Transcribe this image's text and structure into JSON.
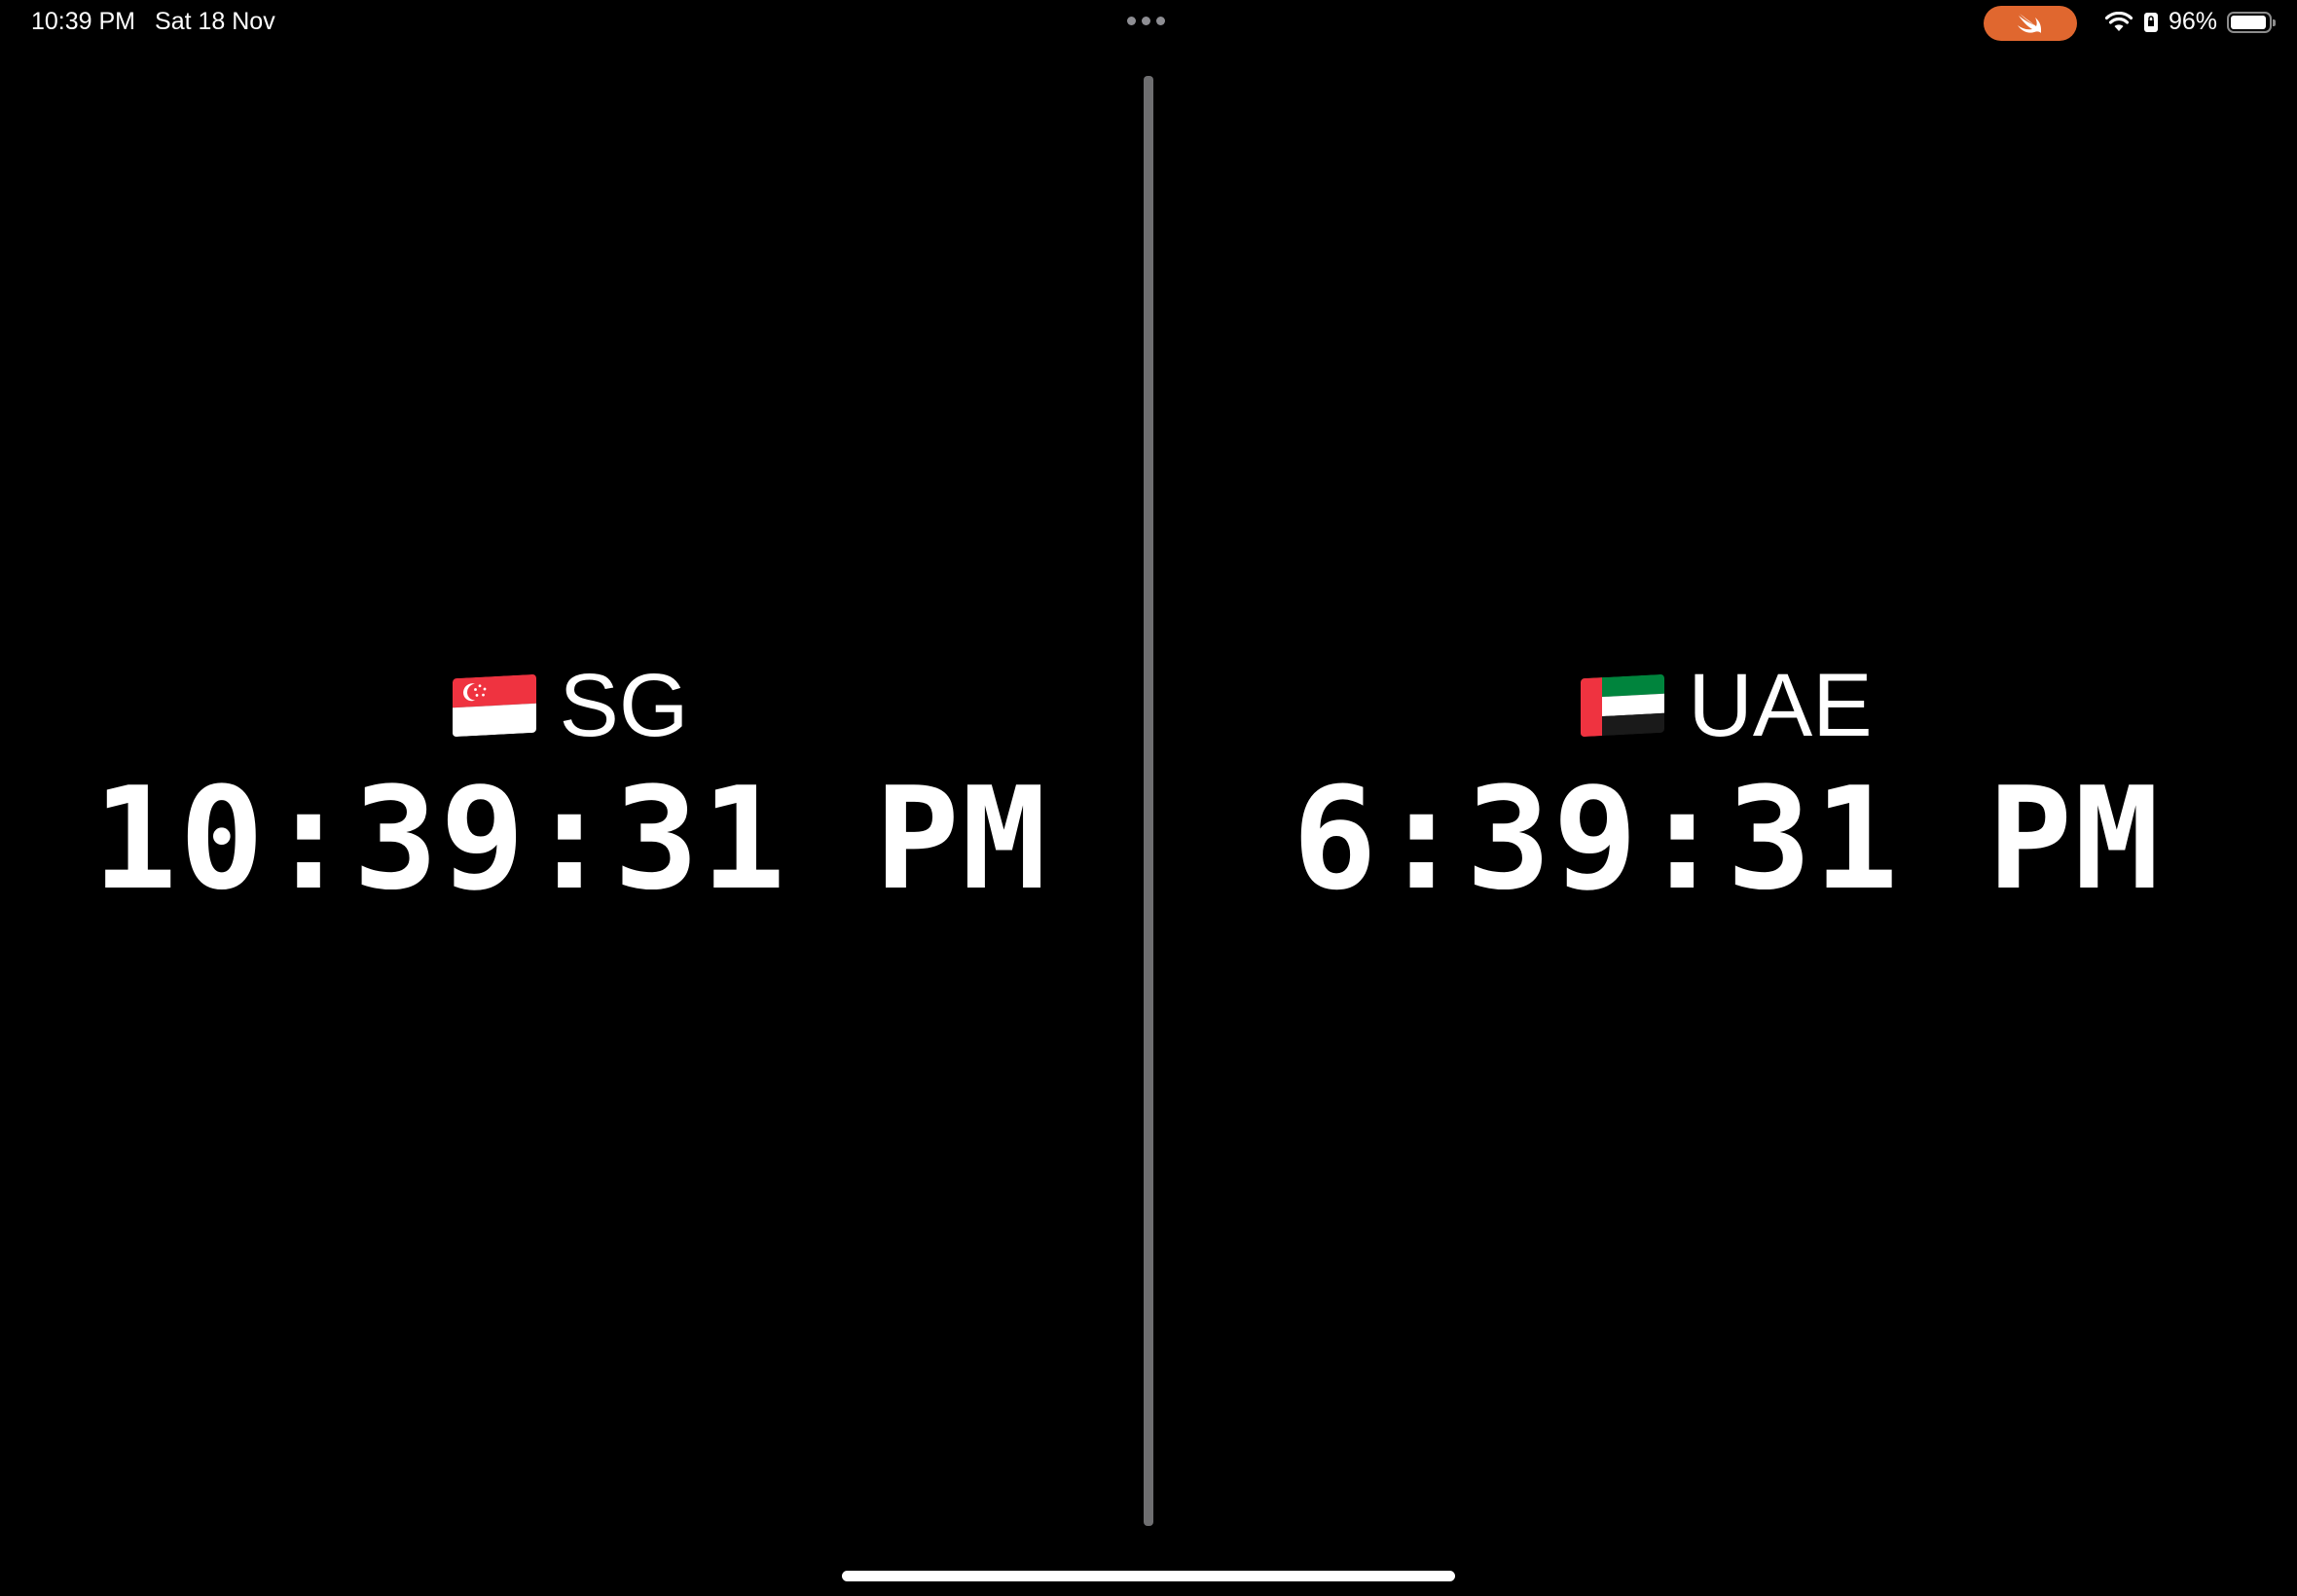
{
  "status_bar": {
    "time": "10:39 PM",
    "date": "Sat 18 Nov",
    "battery_percent_label": "96%",
    "battery_level": 0.96,
    "swift_pill_color": "#e0672f",
    "icons": [
      "more-dots-icon",
      "swift-icon",
      "wifi-icon",
      "lock-rotation-icon",
      "battery-icon"
    ]
  },
  "clocks": [
    {
      "flag": "singapore-flag-icon",
      "city": "SG",
      "time": "10:39:31 PM"
    },
    {
      "flag": "uae-flag-icon",
      "city": "UAE",
      "time": "6:39:31 PM"
    }
  ],
  "colors": {
    "background": "#000000",
    "text": "#ffffff",
    "divider": "#6e6e70"
  }
}
